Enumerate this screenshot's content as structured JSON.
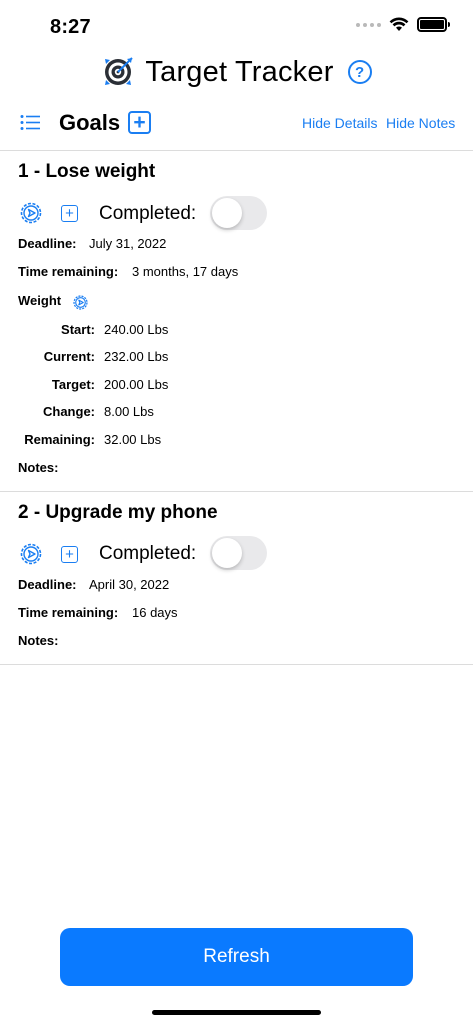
{
  "status_bar": {
    "time": "8:27"
  },
  "app": {
    "title": "Target Tracker",
    "help_icon": "?"
  },
  "toolbar": {
    "goals_label": "Goals",
    "add_icon": "+",
    "hide_details_label": "Hide Details",
    "hide_notes_label": "Hide Notes"
  },
  "goals": [
    {
      "title": "1 - Lose weight",
      "add_icon": "+",
      "completed_label": "Completed:",
      "completed": false,
      "deadline_label": "Deadline:",
      "deadline": "July 31, 2022",
      "time_remaining_label": "Time remaining:",
      "time_remaining": "3 months, 17 days",
      "metric_name": "Weight",
      "metrics": [
        {
          "label": "Start:",
          "value": "240.00 Lbs"
        },
        {
          "label": "Current:",
          "value": "232.00 Lbs"
        },
        {
          "label": "Target:",
          "value": "200.00 Lbs"
        },
        {
          "label": "Change:",
          "value": "8.00 Lbs"
        },
        {
          "label": "Remaining:",
          "value": "32.00 Lbs"
        }
      ],
      "notes_label": "Notes:"
    },
    {
      "title": "2 - Upgrade my phone",
      "add_icon": "+",
      "completed_label": "Completed:",
      "completed": false,
      "deadline_label": "Deadline:",
      "deadline": "April 30, 2022",
      "time_remaining_label": "Time remaining:",
      "time_remaining": "16 days",
      "notes_label": "Notes:"
    }
  ],
  "refresh_label": "Refresh",
  "icons": {
    "app_logo": "target-icon",
    "list": "list-icon",
    "settings": "gear-icon",
    "add": "plus-square-icon",
    "help": "question-circle-icon"
  },
  "colors": {
    "accent": "#1a7ef2",
    "button_fill": "#0a7aff",
    "toggle_off": "#e9e9eb",
    "divider": "#dcdcdc"
  }
}
